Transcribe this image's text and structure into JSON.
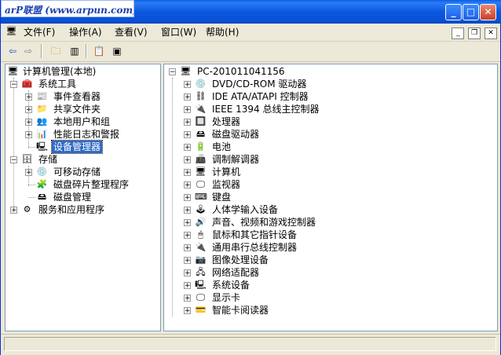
{
  "window": {
    "title_logo": "arP联盟 (www.arpun.com)"
  },
  "menu": [
    "文件(F)",
    "操作(A)",
    "查看(V)",
    "窗口(W)",
    "帮助(H)"
  ],
  "left_tree": {
    "root": "计算机管理(本地)",
    "system_tools": "系统工具",
    "system_children": [
      "事件查看器",
      "共享文件夹",
      "本地用户和组",
      "性能日志和警报",
      "设备管理器"
    ],
    "storage": "存储",
    "storage_children": [
      "可移动存储",
      "磁盘碎片整理程序",
      "磁盘管理"
    ],
    "services": "服务和应用程序"
  },
  "right_tree": {
    "computer": "PC-201011041156",
    "devices": [
      "DVD/CD-ROM 驱动器",
      "IDE ATA/ATAPI 控制器",
      "IEEE 1394 总线主控制器",
      "处理器",
      "磁盘驱动器",
      "电池",
      "调制解调器",
      "计算机",
      "监视器",
      "键盘",
      "人体学输入设备",
      "声音、视频和游戏控制器",
      "鼠标和其它指针设备",
      "通用串行总线控制器",
      "图像处理设备",
      "网络适配器",
      "系统设备",
      "显示卡",
      "智能卡阅读器"
    ]
  }
}
